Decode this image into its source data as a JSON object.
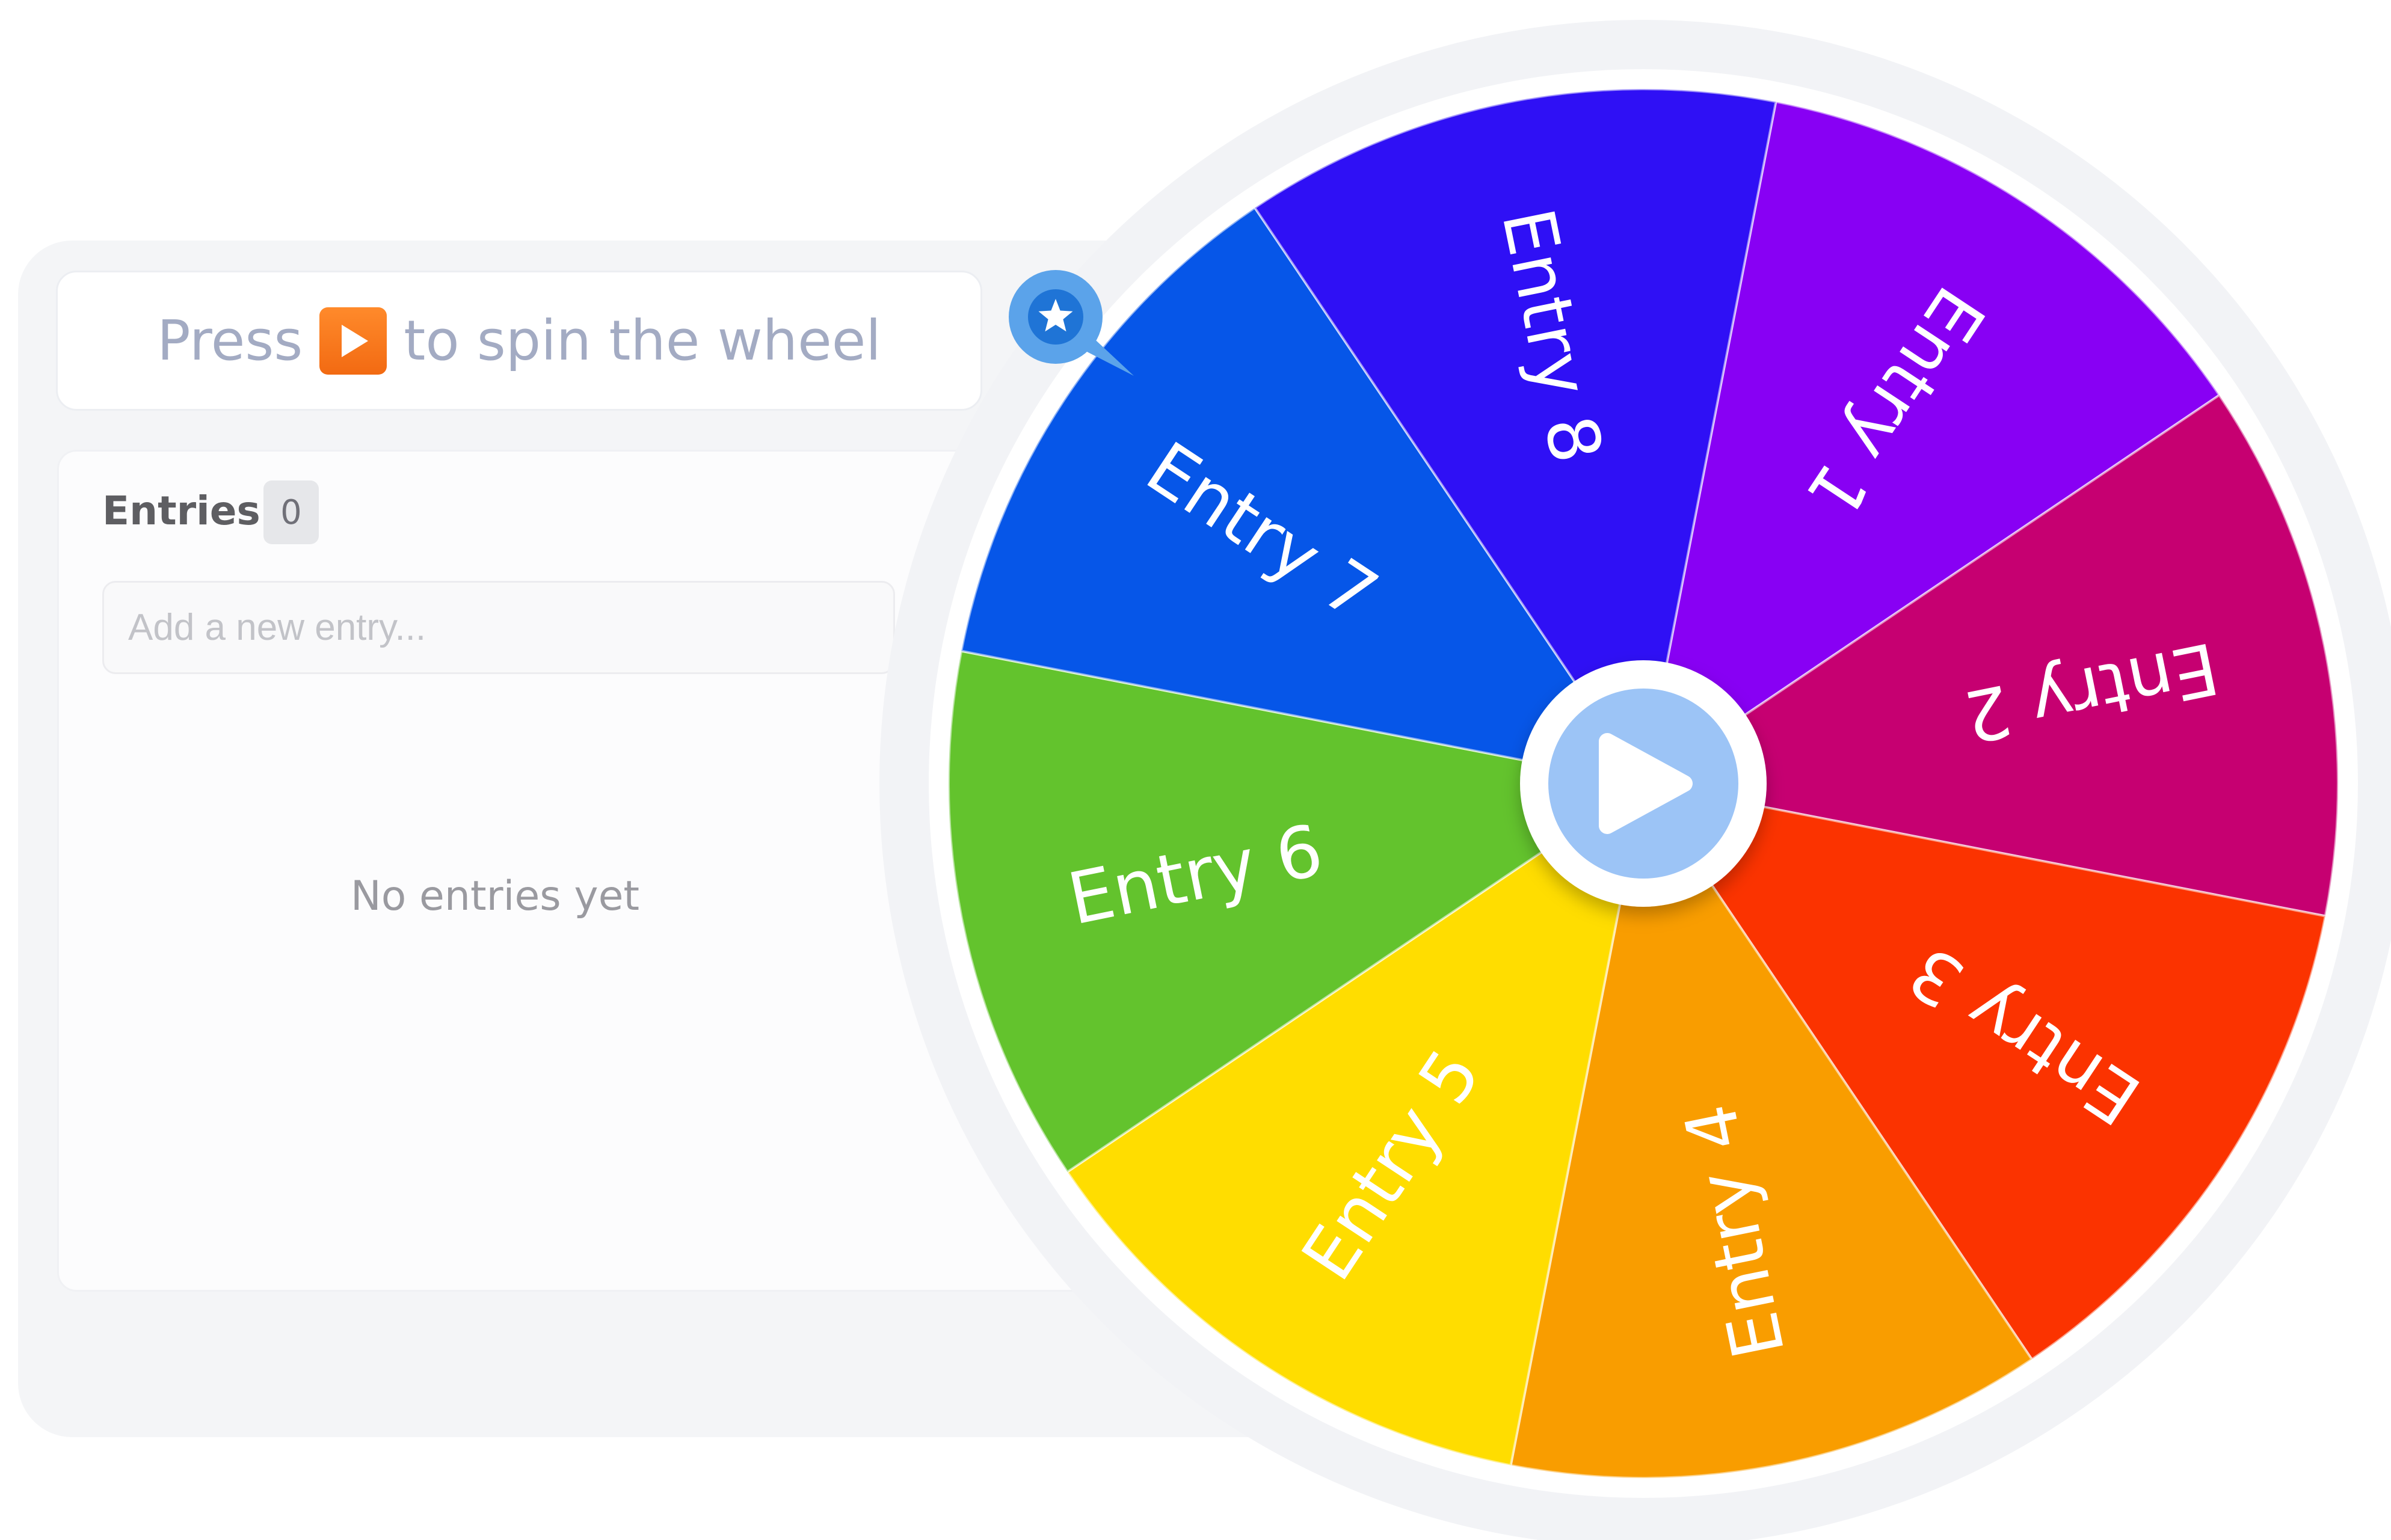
{
  "prompt": {
    "before": "Press",
    "after": "to spin the wheel",
    "icon": "play-icon"
  },
  "entries": {
    "title": "Entries",
    "count": "0",
    "input_placeholder": "Add a new entry...",
    "empty_text": "No entries yet"
  },
  "wheel": {
    "segments": [
      {
        "label": "Entry 1",
        "color": "#8800f4"
      },
      {
        "label": "Entry 2",
        "color": "#c60071"
      },
      {
        "label": "Entry 3",
        "color": "#fb3300"
      },
      {
        "label": "Entry 4",
        "color": "#f99d00"
      },
      {
        "label": "Entry 5",
        "color": "#ffdd00"
      },
      {
        "label": "Entry 6",
        "color": "#63c32d"
      },
      {
        "label": "Entry 7",
        "color": "#0656e8"
      },
      {
        "label": "Entry 8",
        "color": "#2f10f5"
      }
    ],
    "spin_button_icon": "play-icon",
    "pin_icon": "star-icon"
  },
  "colors": {
    "accent": "#f26a12",
    "spin_button": "#9cc4f6",
    "pin": "#5ba3ea"
  }
}
